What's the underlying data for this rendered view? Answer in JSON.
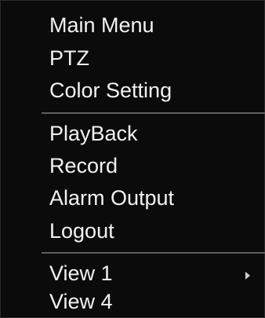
{
  "menu": {
    "group1": [
      {
        "label": "Main Menu"
      },
      {
        "label": "PTZ"
      },
      {
        "label": "Color Setting"
      }
    ],
    "group2": [
      {
        "label": "PlayBack"
      },
      {
        "label": "Record"
      },
      {
        "label": "Alarm Output"
      },
      {
        "label": "Logout"
      }
    ],
    "group3": [
      {
        "label": "View 1",
        "submenu_icon": "chevron-right-icon"
      },
      {
        "label": "View 4"
      }
    ]
  },
  "colors": {
    "background": "#0b0b0b",
    "text": "#f2f2f2",
    "divider": "#5e5e5e"
  }
}
